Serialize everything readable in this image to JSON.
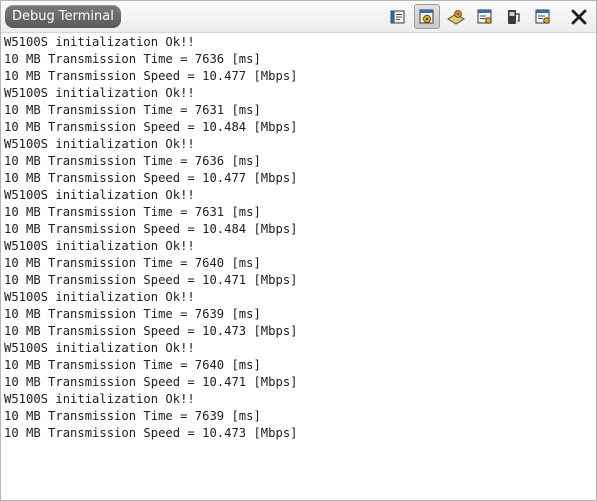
{
  "window": {
    "title": "Debug Terminal"
  },
  "toolbar": {
    "buttons": [
      {
        "name": "book-icon",
        "active": false
      },
      {
        "name": "settings-gear-icon",
        "active": true
      },
      {
        "name": "keyboard-settings-icon",
        "active": false
      },
      {
        "name": "window-settings-icon",
        "active": false
      },
      {
        "name": "power-icon",
        "active": false
      },
      {
        "name": "list-settings-icon",
        "active": false
      }
    ],
    "close": "close-icon"
  },
  "terminal": {
    "lines": [
      "W5100S initialization Ok!!",
      "10 MB Transmission Time = 7636 [ms]",
      "10 MB Transmission Speed = 10.477 [Mbps]",
      "W5100S initialization Ok!!",
      "10 MB Transmission Time = 7631 [ms]",
      "10 MB Transmission Speed = 10.484 [Mbps]",
      "W5100S initialization Ok!!",
      "10 MB Transmission Time = 7636 [ms]",
      "10 MB Transmission Speed = 10.477 [Mbps]",
      "W5100S initialization Ok!!",
      "10 MB Transmission Time = 7631 [ms]",
      "10 MB Transmission Speed = 10.484 [Mbps]",
      "W5100S initialization Ok!!",
      "10 MB Transmission Time = 7640 [ms]",
      "10 MB Transmission Speed = 10.471 [Mbps]",
      "W5100S initialization Ok!!",
      "10 MB Transmission Time = 7639 [ms]",
      "10 MB Transmission Speed = 10.473 [Mbps]",
      "W5100S initialization Ok!!",
      "10 MB Transmission Time = 7640 [ms]",
      "10 MB Transmission Speed = 10.471 [Mbps]",
      "W5100S initialization Ok!!",
      "10 MB Transmission Time = 7639 [ms]",
      "10 MB Transmission Speed = 10.473 [Mbps]"
    ]
  },
  "colors": {
    "title_bg": "#666666",
    "text": "#202020",
    "background": "#ffffff"
  }
}
